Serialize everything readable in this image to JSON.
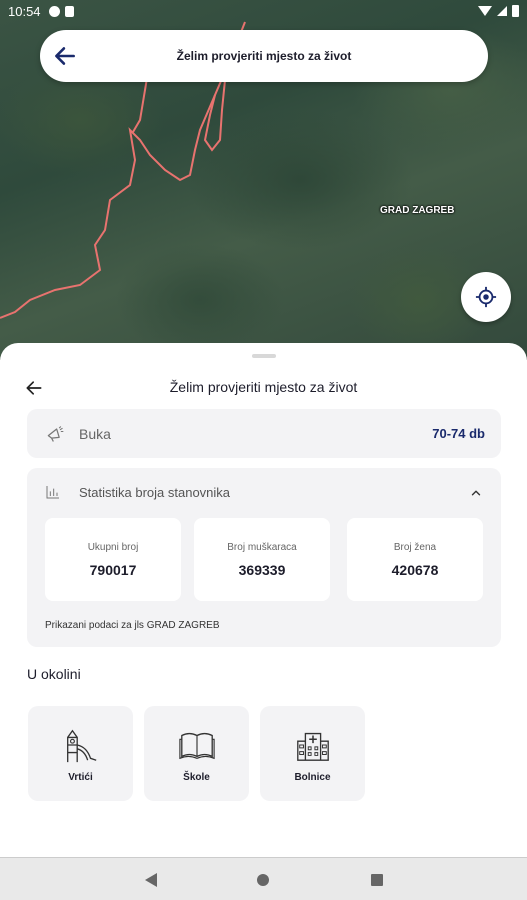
{
  "status_bar": {
    "time": "10:54"
  },
  "top_bar": {
    "title": "Želim provjeriti mjesto za život",
    "back_icon": "arrow-left-icon"
  },
  "map": {
    "label": "GRAD ZAGREB",
    "boundary_color": "#e8736f"
  },
  "sheet": {
    "title": "Želim provjeriti mjesto za život",
    "noise": {
      "label": "Buka",
      "value": "70-74 db",
      "icon": "megaphone-icon"
    },
    "stats": {
      "title": "Statistika broja stanovnika",
      "icon": "bar-chart-icon",
      "total_label": "Ukupni broj",
      "total_value": "790017",
      "men_label": "Broj muškaraca",
      "men_value": "369339",
      "women_label": "Broj žena",
      "women_value": "420678",
      "note": "Prikazani podaci za jls GRAD ZAGREB"
    },
    "nearby": {
      "title": "U okolini",
      "items": [
        {
          "label": "Vrtići",
          "icon": "playground-icon"
        },
        {
          "label": "Škole",
          "icon": "book-icon"
        },
        {
          "label": "Bolnice",
          "icon": "hospital-icon"
        }
      ]
    }
  },
  "colors": {
    "accent": "#1a2a6c",
    "card_bg": "#f3f3f5"
  }
}
